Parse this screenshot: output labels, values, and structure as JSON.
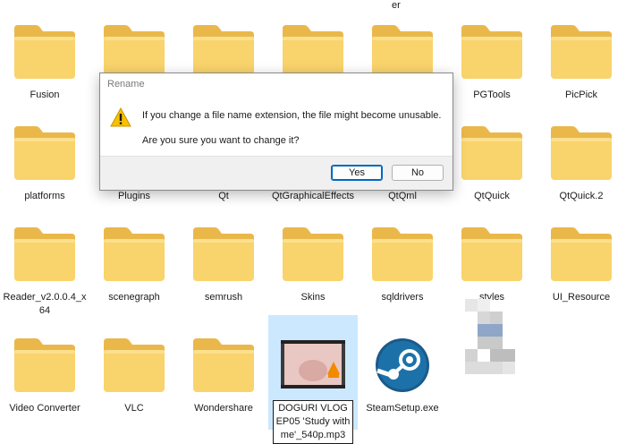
{
  "explorer": {
    "top_partial_label": "er",
    "items": [
      {
        "label": "Fusion",
        "kind": "folder"
      },
      {
        "label": "",
        "kind": "folder"
      },
      {
        "label": "",
        "kind": "folder"
      },
      {
        "label": "",
        "kind": "folder"
      },
      {
        "label": "",
        "kind": "folder"
      },
      {
        "label": "PGTools",
        "kind": "folder"
      },
      {
        "label": "PicPick",
        "kind": "folder"
      },
      {
        "label": "platforms",
        "kind": "folder"
      },
      {
        "label": "Plugins",
        "kind": "folder"
      },
      {
        "label": "Qt",
        "kind": "folder"
      },
      {
        "label": "QtGraphicalEffects",
        "kind": "folder"
      },
      {
        "label": "QtQml",
        "kind": "folder"
      },
      {
        "label": "QtQuick",
        "kind": "folder"
      },
      {
        "label": "QtQuick.2",
        "kind": "folder"
      },
      {
        "label": "Reader_v2.0.0.4_x64",
        "kind": "folder"
      },
      {
        "label": "scenegraph",
        "kind": "folder"
      },
      {
        "label": "semrush",
        "kind": "folder"
      },
      {
        "label": "Skins",
        "kind": "folder"
      },
      {
        "label": "sqldrivers",
        "kind": "folder"
      },
      {
        "label": "styles",
        "kind": "folder"
      },
      {
        "label": "UI_Resource",
        "kind": "folder"
      },
      {
        "label": "Video Converter",
        "kind": "folder"
      },
      {
        "label": "VLC",
        "kind": "folder"
      },
      {
        "label": "Wondershare",
        "kind": "folder"
      },
      {
        "label": "DOGURI VLOG EP05 'Study with me'_540p.mp3",
        "kind": "video",
        "selected": true
      },
      {
        "label": "SteamSetup.exe",
        "kind": "steam"
      },
      {
        "label": "",
        "kind": "pixelated"
      }
    ]
  },
  "dialog": {
    "title": "Rename",
    "message_line1": "If you change a file name extension, the file might become unusable.",
    "message_line2": "Are you sure you want to change it?",
    "yes_label": "Yes",
    "no_label": "No",
    "icon": "warning-icon"
  },
  "colors": {
    "folder_body": "#f9d36b",
    "folder_tab": "#eab84a",
    "selection": "#cce8ff",
    "accent": "#0067c0"
  }
}
